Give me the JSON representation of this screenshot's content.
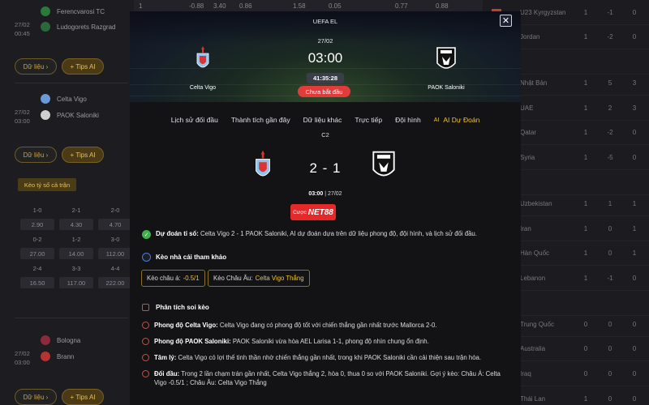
{
  "background": {
    "top_strip": [
      "1",
      "-0.88",
      "3.40",
      "0.86",
      "1.58",
      "0.05",
      "0.77",
      "0.88"
    ],
    "matches": [
      {
        "time": "27/02",
        "time2": "00:45",
        "home": "Ferencvarosi TC",
        "away": "Ludogorets Razgrad"
      },
      {
        "time": "27/02",
        "time2": "03:00",
        "home": "Celta Vigo",
        "away": "PAOK Saloniki"
      },
      {
        "time": "27/02",
        "time2": "03:00",
        "home": "Bologna",
        "away": "Brann"
      }
    ],
    "btn_data": "Dữ liệu",
    "btn_tips": "Tips AI",
    "odds_tab": "Kèo tỷ số cả trận",
    "odds_rows": [
      [
        "1-0",
        "2-1",
        "2-0"
      ],
      [
        "2.90",
        "4.30",
        "4.70"
      ],
      [
        "0-2",
        "1-2",
        "3-0"
      ],
      [
        "27.00",
        "14.00",
        "112.00"
      ],
      [
        "2-4",
        "3-3",
        "4-4"
      ],
      [
        "16.50",
        "117.00",
        "222.00"
      ]
    ],
    "standings": [
      {
        "team": "U23 Kyrgyzstan",
        "a": "1",
        "b": "-1",
        "c": "0",
        "flag": "#c93b2f"
      },
      {
        "team": "Jordan",
        "a": "1",
        "b": "-2",
        "c": "0",
        "flag": "#2c6a3a"
      },
      {
        "team": "",
        "a": "",
        "b": "",
        "c": "",
        "flag": ""
      },
      {
        "team": "Nhật Bản",
        "a": "1",
        "b": "5",
        "c": "3",
        "flag": "#e8e8e8"
      },
      {
        "team": "UAE",
        "a": "1",
        "b": "2",
        "c": "3",
        "flag": "#2a7a3a"
      },
      {
        "team": "Qatar",
        "a": "1",
        "b": "-2",
        "c": "0",
        "flag": "#7a1d33"
      },
      {
        "team": "Syria",
        "a": "1",
        "b": "-5",
        "c": "0",
        "flag": "#c73a3a"
      },
      {
        "team": "",
        "a": "",
        "b": "",
        "c": "",
        "flag": ""
      },
      {
        "team": "Uzbekistan",
        "a": "1",
        "b": "1",
        "c": "1",
        "flag": "#3a7ac9"
      },
      {
        "team": "Iran",
        "a": "1",
        "b": "0",
        "c": "1",
        "flag": "#2e8a4a"
      },
      {
        "team": "Hàn Quốc",
        "a": "1",
        "b": "0",
        "c": "1",
        "flag": "#e8e8e8"
      },
      {
        "team": "Lebanon",
        "a": "1",
        "b": "-1",
        "c": "0",
        "flag": "#c73a3a"
      },
      {
        "team": "",
        "a": "",
        "b": "",
        "c": "",
        "flag": ""
      },
      {
        "team": "Trung Quốc",
        "a": "0",
        "b": "0",
        "c": "0",
        "flag": "#d23a2a"
      },
      {
        "team": "Australia",
        "a": "0",
        "b": "0",
        "c": "0",
        "flag": "#2a3a8a"
      },
      {
        "team": "Iraq",
        "a": "0",
        "b": "0",
        "c": "0",
        "flag": "#c73a3a"
      },
      {
        "team": "Thái Lan",
        "a": "1",
        "b": "0",
        "c": "0",
        "flag": "#2a3a8a"
      }
    ]
  },
  "modal": {
    "league": "UEFA EL",
    "date": "27/02",
    "time": "03:00",
    "countdown": "41:35:28",
    "status": "Chưa bắt đầu",
    "home": "Celta Vigo",
    "away": "PAOK Saloniki",
    "tabs": [
      "Lịch sử đối đầu",
      "Thành tích gần đây",
      "Dữ liệu khác",
      "Trực tiếp",
      "Đội hình"
    ],
    "ai_badge": "AI",
    "ai_tab": "AI Dự Đoán",
    "round": "C2",
    "score": "2 - 1",
    "kickoff_time": "03:00",
    "kickoff_date": "| 27/02",
    "sponsor_prefix": "Cược",
    "sponsor_brand": "NET88",
    "prediction_label": "Dự đoán tỉ số:",
    "prediction_text": "Celta Vigo 2 - 1 PAOK Saloniki, AI dự đoán dựa trên dữ liệu phong độ, đội hình, và lịch sử đối đầu.",
    "bookie_title": "Kèo nhà cái tham khảo",
    "asian_label": "Kèo châu á:",
    "asian_value": "-0.5/1",
    "euro_label": "Kèo Châu Âu:",
    "euro_value": "Celta Vigo Thắng",
    "analysis_title": "Phân tích soi kèo",
    "analysis": [
      {
        "label": "Phong độ Celta Vigo:",
        "text": "Celta Vigo đang có phong độ tốt với chiến thắng gần nhất trước Mallorca 2-0."
      },
      {
        "label": "Phong độ PAOK Saloniki:",
        "text": "PAOK Saloniki vừa hòa AEL Larisa 1-1, phong độ nhìn chung ổn định."
      },
      {
        "label": "Tâm lý:",
        "text": "Celta Vigo có lợi thế tinh thần nhờ chiến thắng gần nhất, trong khi PAOK Saloniki cần cải thiện sau trận hòa."
      },
      {
        "label": "Đối đầu:",
        "text": "Trong 2 lần chạm trán gần nhất, Celta Vigo thắng 2, hòa 0, thua 0 so với PAOK Saloniki. Gợi ý kèo: Châu Á: Celta Vigo -0.5/1 ; Châu Âu: Celta Vigo Thắng"
      }
    ]
  }
}
